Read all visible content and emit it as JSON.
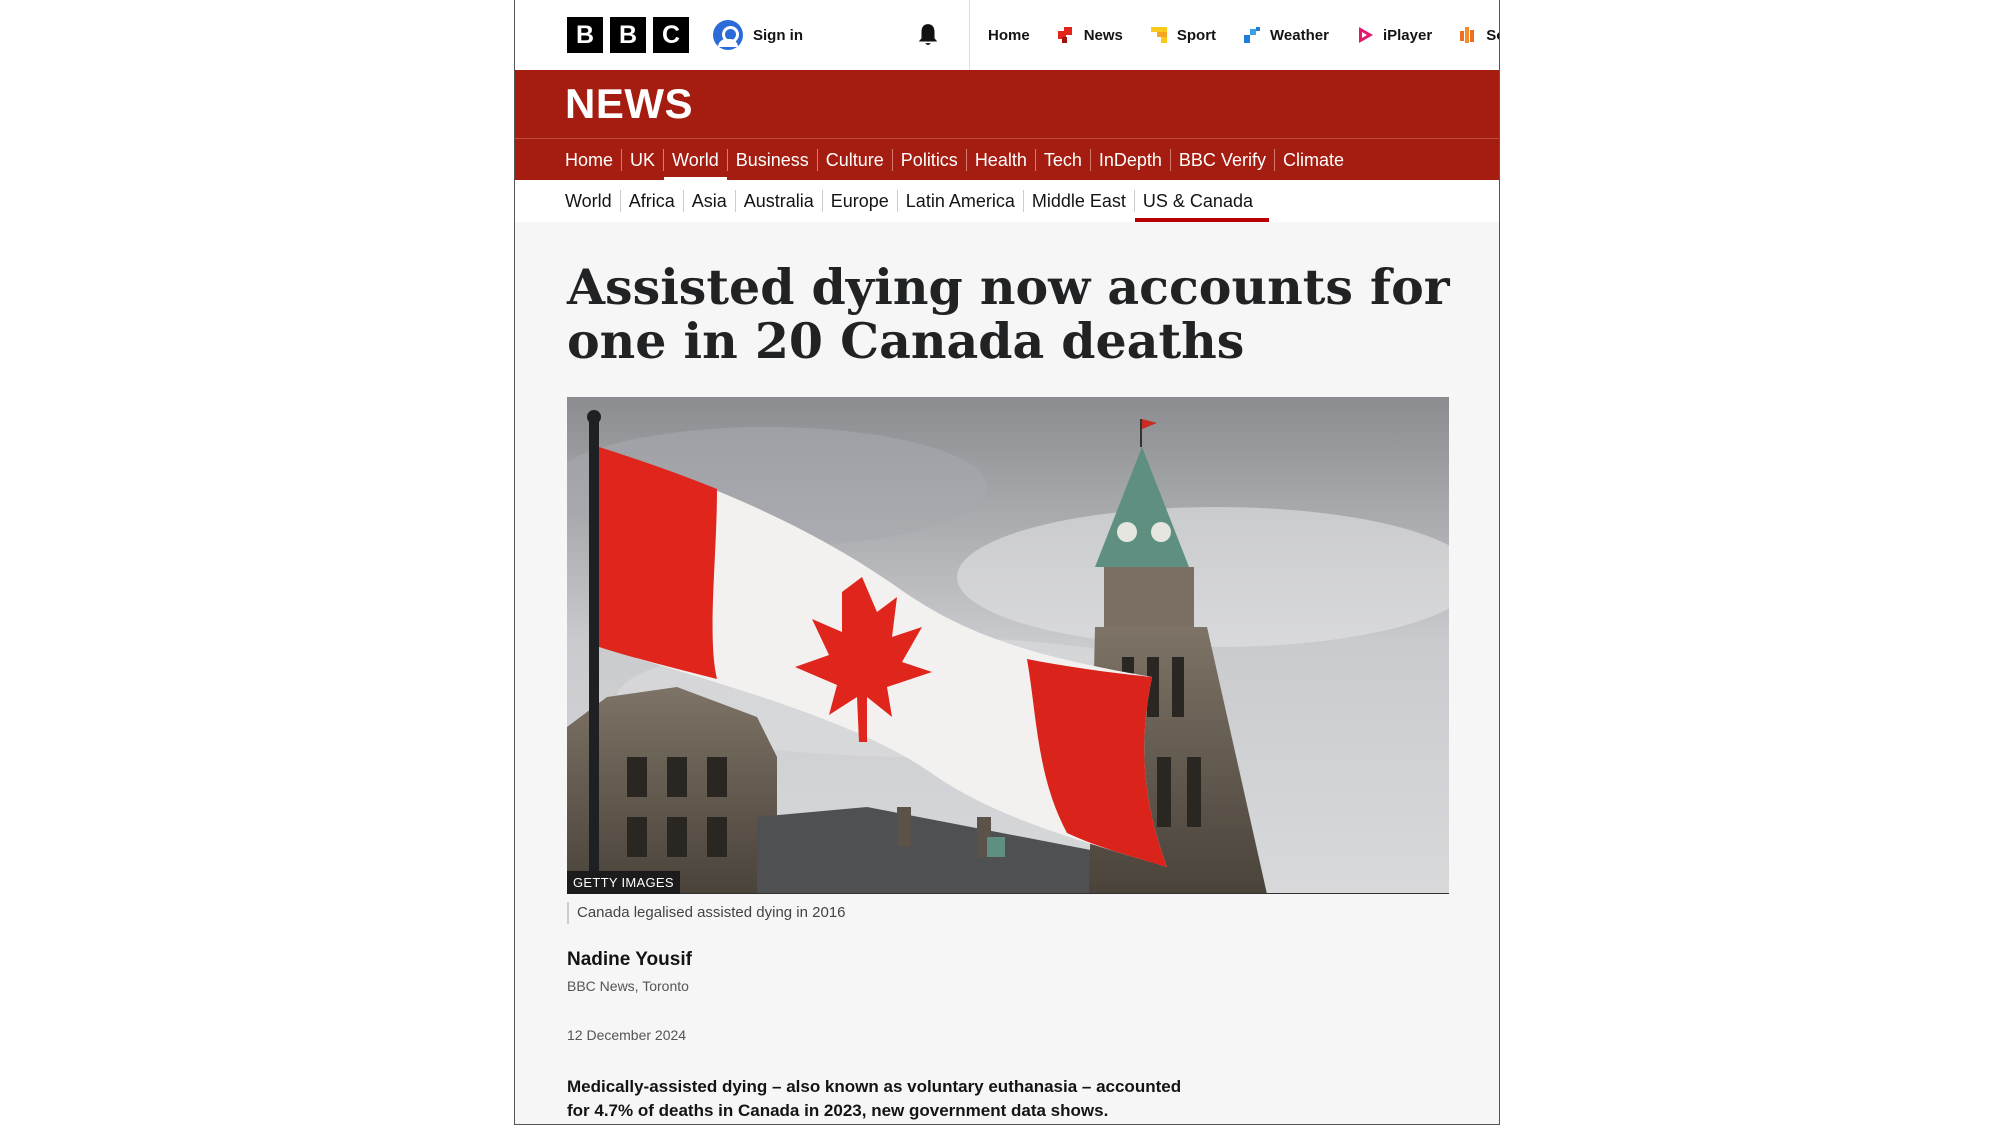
{
  "brand": {
    "letters": [
      "B",
      "B",
      "C"
    ]
  },
  "topbar": {
    "sign_in": "Sign in",
    "nav": [
      {
        "label": "Home",
        "icon": ""
      },
      {
        "label": "News",
        "icon": "news-icon",
        "color": "#e2241a"
      },
      {
        "label": "Sport",
        "icon": "sport-icon",
        "color": "#f9c91c"
      },
      {
        "label": "Weather",
        "icon": "weather-icon",
        "color": "#1f7ed6"
      },
      {
        "label": "iPlayer",
        "icon": "iplayer-icon",
        "color": "#e5186f"
      },
      {
        "label": "So",
        "icon": "sounds-icon",
        "color": "#ee6f21"
      }
    ]
  },
  "banner": {
    "title": "NEWS"
  },
  "main_nav": {
    "items": [
      "Home",
      "UK",
      "World",
      "Business",
      "Culture",
      "Politics",
      "Health",
      "Tech",
      "InDepth",
      "BBC Verify",
      "Climate"
    ],
    "active": "World"
  },
  "sub_nav": {
    "items": [
      "World",
      "Africa",
      "Asia",
      "Australia",
      "Europe",
      "Latin America",
      "Middle East",
      "US & Canada"
    ],
    "active": "US & Canada"
  },
  "article": {
    "headline": "Assisted dying now accounts for one in 20 Canada deaths",
    "image_credit": "GETTY IMAGES",
    "caption": "Canada legalised assisted dying in 2016",
    "author": "Nadine Yousif",
    "author_role": "BBC News, Toronto",
    "date": "12 December 2024",
    "lede": "Medically-assisted dying – also known as voluntary euthanasia – accounted for 4.7% of deaths in Canada in 2023, new government data shows."
  },
  "colors": {
    "news_red": "#a51c11",
    "active_underline": "#b80000"
  }
}
